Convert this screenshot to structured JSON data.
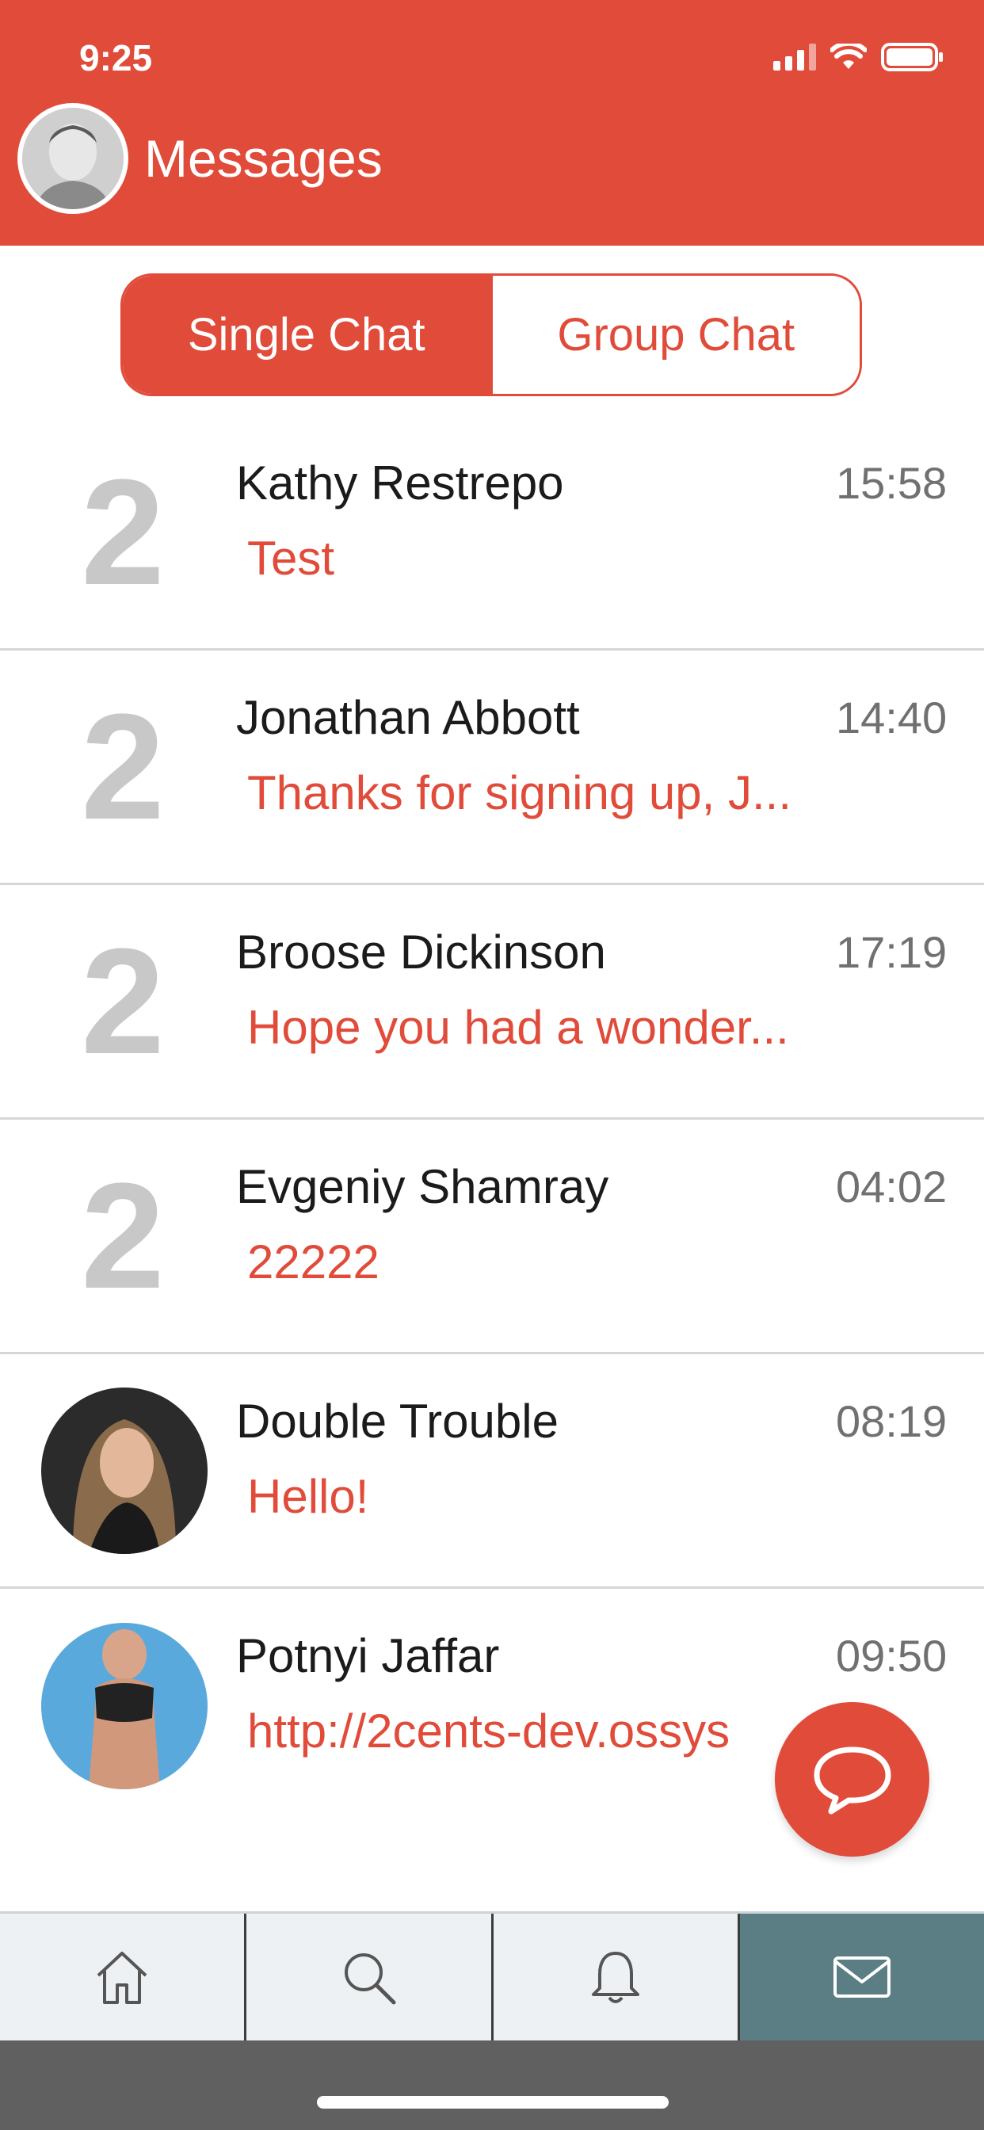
{
  "status_bar": {
    "time": "9:25"
  },
  "header": {
    "title": "Messages"
  },
  "segment": {
    "single_label": "Single Chat",
    "group_label": "Group Chat",
    "selected": "Single Chat"
  },
  "chats": [
    {
      "name": "Kathy Restrepo",
      "message": "Test",
      "time": "15:58",
      "avatar_text": "2"
    },
    {
      "name": "Jonathan Abbott",
      "message": "Thanks for signing up, J...",
      "time": "14:40",
      "avatar_text": "2"
    },
    {
      "name": "Broose Dickinson",
      "message": "Hope you had a wonder...",
      "time": "17:19",
      "avatar_text": "2"
    },
    {
      "name": "Evgeniy Shamray",
      "message": "22222",
      "time": "04:02",
      "avatar_text": "2"
    },
    {
      "name": "Double Trouble",
      "message": "Hello!",
      "time": "08:19"
    },
    {
      "name": "Potnyi Jaffar",
      "message": "http://2cents-dev.ossys",
      "time": "09:50"
    }
  ],
  "tabbar": {
    "items": [
      {
        "icon": "home-icon"
      },
      {
        "icon": "search-icon"
      },
      {
        "icon": "bell-icon"
      },
      {
        "icon": "mail-icon",
        "active": true
      }
    ]
  },
  "colors": {
    "accent": "#E14B3A",
    "active_tab": "#5A7E83",
    "tab_bg": "#EEF1F3"
  }
}
